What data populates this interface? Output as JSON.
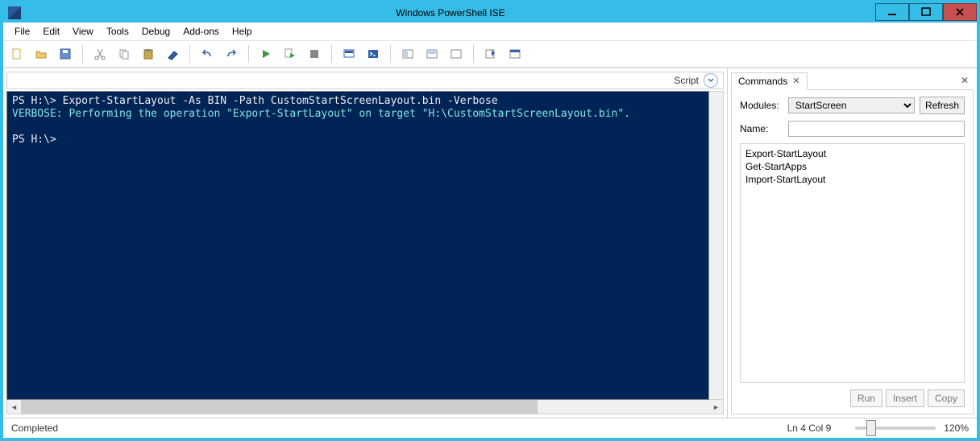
{
  "titlebar": {
    "title": "Windows PowerShell ISE"
  },
  "menu": {
    "items": [
      "File",
      "Edit",
      "View",
      "Tools",
      "Debug",
      "Add-ons",
      "Help"
    ]
  },
  "script_pane": {
    "label": "Script"
  },
  "console": {
    "lines": [
      {
        "cls": "prompt",
        "text": "PS H:\\> Export-StartLayout -As BIN -Path CustomStartScreenLayout.bin -Verbose"
      },
      {
        "cls": "verbose",
        "text": "VERBOSE: Performing the operation \"Export-StartLayout\" on target \"H:\\CustomStartScreenLayout.bin\"."
      },
      {
        "cls": "prompt",
        "text": ""
      },
      {
        "cls": "prompt",
        "text": "PS H:\\> "
      }
    ]
  },
  "commands_pane": {
    "tab_label": "Commands",
    "modules_label": "Modules:",
    "name_label": "Name:",
    "modules_selected": "StartScreen",
    "refresh_label": "Refresh",
    "list": [
      "Export-StartLayout",
      "Get-StartApps",
      "Import-StartLayout"
    ],
    "actions": {
      "run": "Run",
      "insert": "Insert",
      "copy": "Copy"
    }
  },
  "status": {
    "left": "Completed",
    "pos": "Ln 4  Col 9",
    "zoom": "120%"
  }
}
